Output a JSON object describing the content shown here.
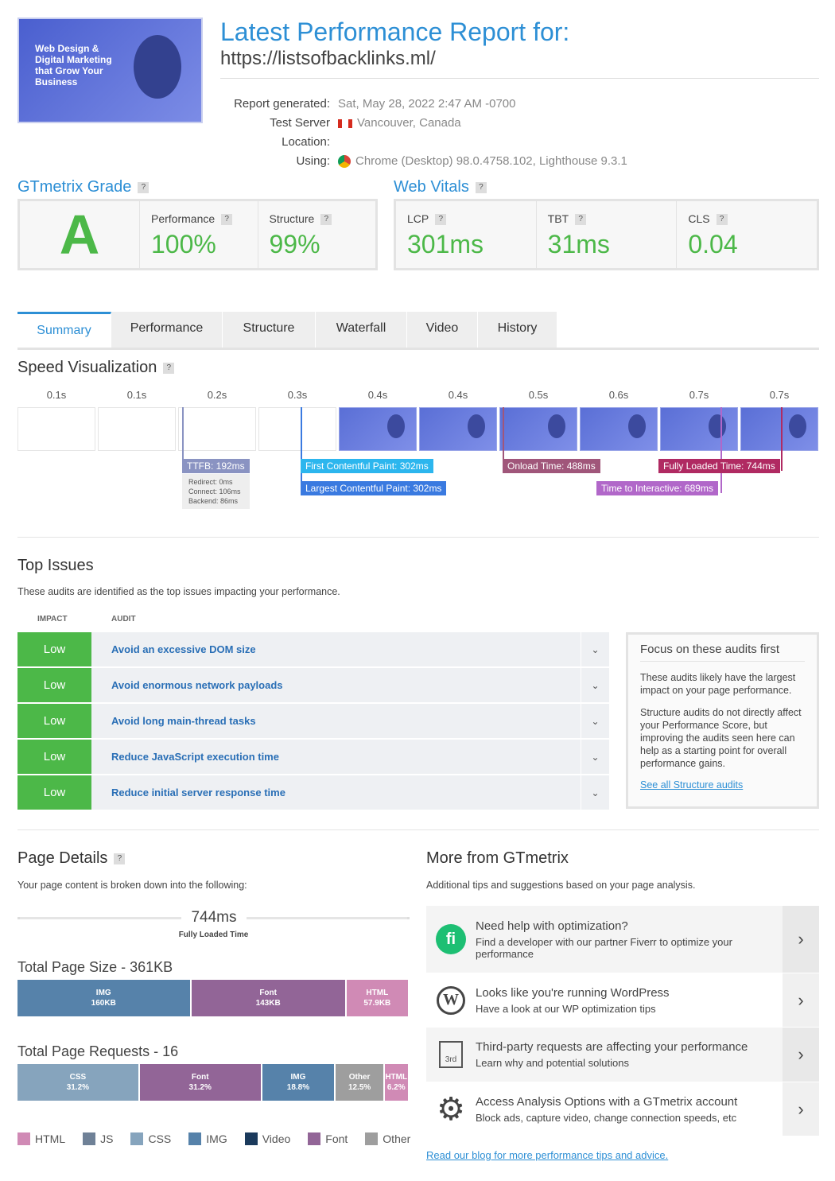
{
  "header": {
    "thumbnail_text": "Web Design & Digital Marketing that Grow Your Business",
    "title": "Latest Performance Report for:",
    "url": "https://listsofbacklinks.ml/",
    "meta": [
      {
        "label": "Report generated:",
        "value": "Sat, May 28, 2022 2:47 AM -0700",
        "icon": ""
      },
      {
        "label": "Test Server Location:",
        "value": "Vancouver, Canada",
        "icon": "canada-flag-icon"
      },
      {
        "label": "Using:",
        "value": "Chrome (Desktop) 98.0.4758.102, Lighthouse 9.3.1",
        "icon": "chrome-icon"
      }
    ]
  },
  "grade": {
    "title": "GTmetrix Grade",
    "help": "?",
    "letter": "A",
    "performance_label": "Performance",
    "performance": "100%",
    "structure_label": "Structure",
    "structure": "99%"
  },
  "vitals": {
    "title": "Web Vitals",
    "help": "?",
    "items": [
      {
        "label": "LCP",
        "value": "301ms"
      },
      {
        "label": "TBT",
        "value": "31ms"
      },
      {
        "label": "CLS",
        "value": "0.04"
      }
    ]
  },
  "tabs": [
    "Summary",
    "Performance",
    "Structure",
    "Waterfall",
    "Video",
    "History"
  ],
  "speed": {
    "title": "Speed Visualization",
    "ticks": [
      "0.1s",
      "0.1s",
      "0.2s",
      "0.3s",
      "0.4s",
      "0.4s",
      "0.5s",
      "0.6s",
      "0.7s",
      "0.7s"
    ],
    "ttfb": "TTFB: 192ms",
    "ttfb_details": [
      "Redirect: 0ms",
      "Connect: 106ms",
      "Backend: 86ms"
    ],
    "fcp": "First Contentful Paint: 302ms",
    "lcp": "Largest Contentful Paint: 302ms",
    "onload": "Onload Time: 488ms",
    "tti": "Time to Interactive: 689ms",
    "fully": "Fully Loaded Time: 744ms"
  },
  "issues": {
    "title": "Top Issues",
    "desc": "These audits are identified as the top issues impacting your performance.",
    "col_impact": "IMPACT",
    "col_audit": "AUDIT",
    "rows": [
      {
        "impact": "Low",
        "audit": "Avoid an excessive DOM size"
      },
      {
        "impact": "Low",
        "audit": "Avoid enormous network payloads"
      },
      {
        "impact": "Low",
        "audit": "Avoid long main-thread tasks"
      },
      {
        "impact": "Low",
        "audit": "Reduce JavaScript execution time"
      },
      {
        "impact": "Low",
        "audit": "Reduce initial server response time"
      }
    ],
    "side_title": "Focus on these audits first",
    "side_p1": "These audits likely have the largest impact on your page performance.",
    "side_p2": "Structure audits do not directly affect your Performance Score, but improving the audits seen here can help as a starting point for overall performance gains.",
    "side_link": "See all Structure audits"
  },
  "details": {
    "title": "Page Details",
    "desc": "Your page content is broken down into the following:",
    "time": "744ms",
    "time_label": "Fully Loaded Time",
    "size_title": "Total Page Size - 361KB",
    "size": [
      {
        "name": "IMG",
        "value": "160KB",
        "kb": 160,
        "color": "#5682aa"
      },
      {
        "name": "Font",
        "value": "143KB",
        "kb": 143,
        "color": "#926597"
      },
      {
        "name": "HTML",
        "value": "57.9KB",
        "kb": 57.9,
        "color": "#d08ab5"
      }
    ],
    "req_title": "Total Page Requests - 16",
    "requests": [
      {
        "name": "CSS",
        "value": "31.2%",
        "pct": 31.2,
        "color": "#86a4bd"
      },
      {
        "name": "Font",
        "value": "31.2%",
        "pct": 31.2,
        "color": "#926597"
      },
      {
        "name": "IMG",
        "value": "18.8%",
        "pct": 18.8,
        "color": "#5682aa"
      },
      {
        "name": "Other",
        "value": "12.5%",
        "pct": 12.5,
        "color": "#9e9e9e"
      },
      {
        "name": "HTML",
        "value": "6.2%",
        "pct": 6.2,
        "color": "#d08ab5"
      }
    ],
    "legend": [
      {
        "name": "HTML",
        "color": "#d08ab5"
      },
      {
        "name": "JS",
        "color": "#6f8197"
      },
      {
        "name": "CSS",
        "color": "#86a4bd"
      },
      {
        "name": "IMG",
        "color": "#5682aa"
      },
      {
        "name": "Video",
        "color": "#1b3a5c"
      },
      {
        "name": "Font",
        "color": "#926597"
      },
      {
        "name": "Other",
        "color": "#9e9e9e"
      }
    ]
  },
  "more": {
    "title": "More from GTmetrix",
    "desc": "Additional tips and suggestions based on your page analysis.",
    "items": [
      {
        "icon": "fiverr-icon",
        "t1": "Need help with optimization?",
        "t2": "Find a developer with our partner Fiverr to optimize your performance"
      },
      {
        "icon": "wordpress-icon",
        "t1": "Looks like you're running WordPress",
        "t2": "Have a look at our WP optimization tips"
      },
      {
        "icon": "third-party-icon",
        "t1": "Third-party requests are affecting your performance",
        "t2": "Learn why and potential solutions",
        "badge": "3rd"
      },
      {
        "icon": "gear-icon",
        "t1": "Access Analysis Options with a GTmetrix account",
        "t2": "Block ads, capture video, change connection speeds, etc"
      }
    ],
    "blog_link": "Read our blog for more performance tips and advice."
  }
}
